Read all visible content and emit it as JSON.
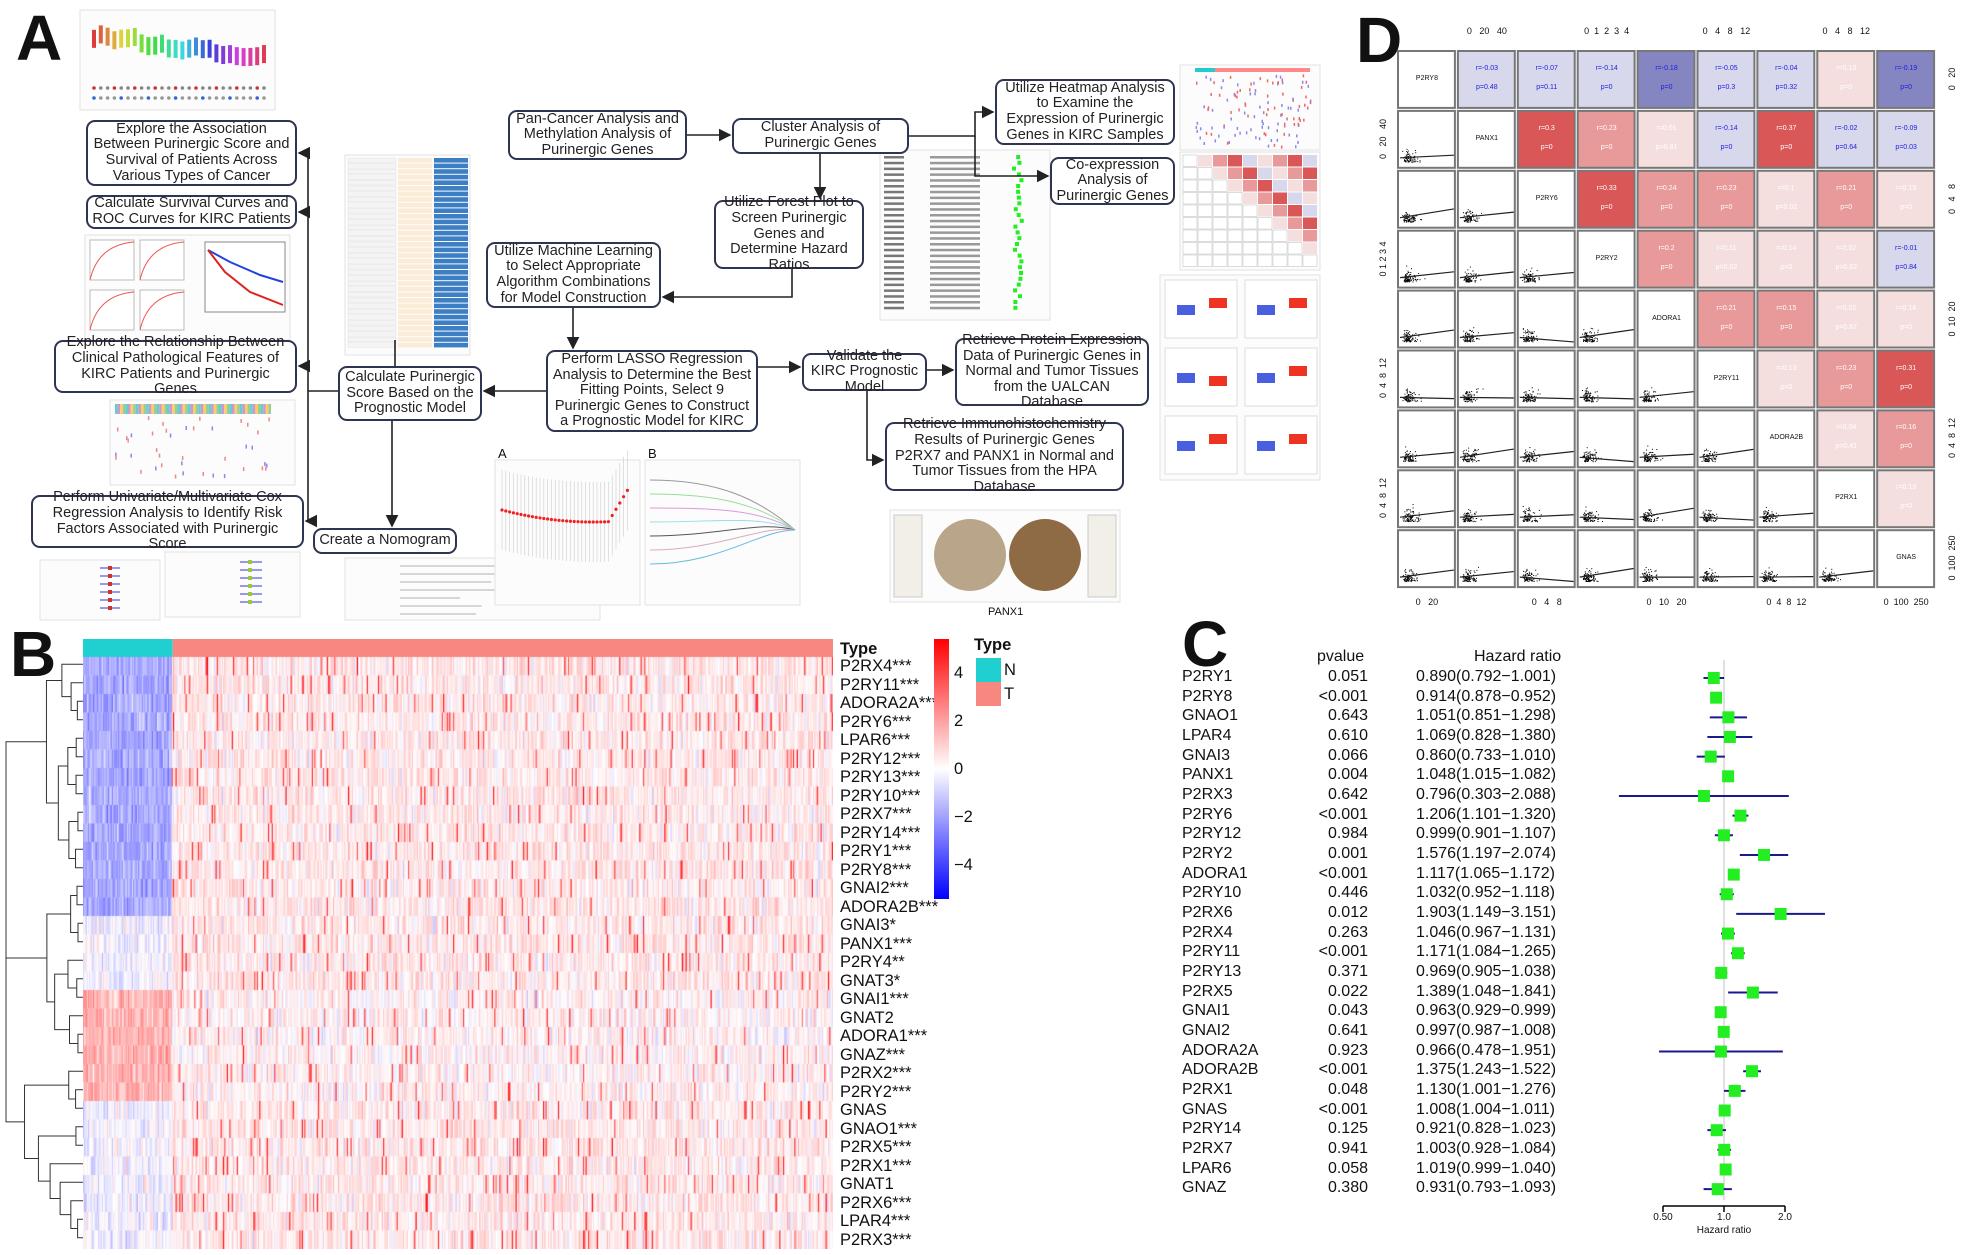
{
  "panels": {
    "a": "A",
    "b": "B",
    "c": "C",
    "d": "D"
  },
  "flowchart": {
    "boxes": [
      {
        "id": "explore-association",
        "text": "Explore the Association Between Purinergic Score and Survival of Patients Across Various Types of Cancer"
      },
      {
        "id": "survival-roc",
        "text": "Calculate Survival Curves and ROC Curves for KIRC Patients"
      },
      {
        "id": "clinical-features",
        "text": "Explore the Relationship Between Clinical Pathological Features of KIRC Patients and Purinergic Genes"
      },
      {
        "id": "cox-regression",
        "text": "Perform Univariate/Multivariate Cox Regression Analysis to Identify Risk Factors Associated with Purinergic Score"
      },
      {
        "id": "purinergic-score",
        "text": "Calculate Purinergic Score Based on the Prognostic Model"
      },
      {
        "id": "nomogram",
        "text": "Create a Nomogram"
      },
      {
        "id": "pan-cancer",
        "text": "Pan-Cancer Analysis and Methylation Analysis of Purinergic Genes"
      },
      {
        "id": "cluster-analysis",
        "text": "Cluster Analysis of Purinergic Genes"
      },
      {
        "id": "forest-plot",
        "text": "Utilize Forest Plot to Screen Purinergic Genes and Determine Hazard Ratios"
      },
      {
        "id": "machine-learning",
        "text": "Utilize Machine Learning to Select Appropriate Algorithm Combinations for Model Construction"
      },
      {
        "id": "lasso",
        "text": "Perform LASSO Regression Analysis to Determine the Best Fitting Points, Select 9 Purinergic Genes to Construct a Prognostic Model for KIRC"
      },
      {
        "id": "validate",
        "text": "Validate the KIRC Prognostic Model"
      },
      {
        "id": "protein-expression",
        "text": "Retrieve Protein Expression Data of Purinergic Genes in Normal and Tumor Tissues from the UALCAN Database"
      },
      {
        "id": "ihc",
        "text": "Retrieve Immunohistochemistry Results of Purinergic Genes P2RX7 and PANX1 in Normal and Tumor Tissues from the HPA Database"
      },
      {
        "id": "heatmap-analysis",
        "text": "Utilize Heatmap Analysis to Examine the Expression of Purinergic Genes in KIRC Samples"
      },
      {
        "id": "co-expression",
        "text": "Co-expression Analysis of Purinergic Genes"
      }
    ],
    "thumb_labels": {
      "lasso_a": "A",
      "lasso_b": "B",
      "ihc_gene": "PANX1"
    }
  },
  "chart_data": [
    {
      "panel": "B",
      "type": "heatmap",
      "annotation_title": "Type",
      "groups": [
        {
          "label": "N",
          "color": "#20d0d0"
        },
        {
          "label": "T",
          "color": "#f8877f"
        }
      ],
      "colorscale": {
        "ticks": [
          "4",
          "2",
          "0",
          "−2",
          "−4"
        ],
        "high": "#ff0000",
        "mid": "#ffffff",
        "low": "#0000ff"
      },
      "rows": [
        "P2RX4***",
        "P2RY11***",
        "ADORA2A***",
        "P2RY6***",
        "LPAR6***",
        "P2RY12***",
        "P2RY13***",
        "P2RY10***",
        "P2RX7***",
        "P2RY14***",
        "P2RY1***",
        "P2RY8***",
        "GNAI2***",
        "ADORA2B***",
        "GNAI3*",
        "PANX1***",
        "P2RY4**",
        "GNAT3*",
        "GNAI1***",
        "GNAT2",
        "ADORA1***",
        "GNAZ***",
        "P2RX2***",
        "P2RY2***",
        "GNAS",
        "GNAO1***",
        "P2RX5***",
        "P2RX1***",
        "GNAT1",
        "P2RX6***",
        "LPAR4***",
        "P2RX3***"
      ]
    },
    {
      "panel": "C",
      "type": "forest",
      "headers": {
        "pvalue": "pvalue",
        "hr": "Hazard ratio"
      },
      "xlabel": "Hazard ratio",
      "xscale": "log",
      "xticks": [
        "0.50",
        "1.0",
        "2.0"
      ],
      "xlim": [
        0.5,
        2.0
      ],
      "marker_color": "#22ee22",
      "ci_color": "#1a1a8c",
      "rows": [
        {
          "gene": "P2RY1",
          "p": "0.051",
          "hr_text": "0.890(0.792−1.001)",
          "hr": 0.89,
          "lo": 0.792,
          "hi": 1.001
        },
        {
          "gene": "P2RY8",
          "p": "<0.001",
          "hr_text": "0.914(0.878−0.952)",
          "hr": 0.914,
          "lo": 0.878,
          "hi": 0.952
        },
        {
          "gene": "GNAO1",
          "p": "0.643",
          "hr_text": "1.051(0.851−1.298)",
          "hr": 1.051,
          "lo": 0.851,
          "hi": 1.298
        },
        {
          "gene": "LPAR4",
          "p": "0.610",
          "hr_text": "1.069(0.828−1.380)",
          "hr": 1.069,
          "lo": 0.828,
          "hi": 1.38
        },
        {
          "gene": "GNAI3",
          "p": "0.066",
          "hr_text": "0.860(0.733−1.010)",
          "hr": 0.86,
          "lo": 0.733,
          "hi": 1.01
        },
        {
          "gene": "PANX1",
          "p": "0.004",
          "hr_text": "1.048(1.015−1.082)",
          "hr": 1.048,
          "lo": 1.015,
          "hi": 1.082
        },
        {
          "gene": "P2RX3",
          "p": "0.642",
          "hr_text": "0.796(0.303−2.088)",
          "hr": 0.796,
          "lo": 0.303,
          "hi": 2.088
        },
        {
          "gene": "P2RY6",
          "p": "<0.001",
          "hr_text": "1.206(1.101−1.320)",
          "hr": 1.206,
          "lo": 1.101,
          "hi": 1.32
        },
        {
          "gene": "P2RY12",
          "p": "0.984",
          "hr_text": "0.999(0.901−1.107)",
          "hr": 0.999,
          "lo": 0.901,
          "hi": 1.107
        },
        {
          "gene": "P2RY2",
          "p": "0.001",
          "hr_text": "1.576(1.197−2.074)",
          "hr": 1.576,
          "lo": 1.197,
          "hi": 2.074
        },
        {
          "gene": "ADORA1",
          "p": "<0.001",
          "hr_text": "1.117(1.065−1.172)",
          "hr": 1.117,
          "lo": 1.065,
          "hi": 1.172
        },
        {
          "gene": "P2RY10",
          "p": "0.446",
          "hr_text": "1.032(0.952−1.118)",
          "hr": 1.032,
          "lo": 0.952,
          "hi": 1.118
        },
        {
          "gene": "P2RX6",
          "p": "0.012",
          "hr_text": "1.903(1.149−3.151)",
          "hr": 1.903,
          "lo": 1.149,
          "hi": 3.151
        },
        {
          "gene": "P2RX4",
          "p": "0.263",
          "hr_text": "1.046(0.967−1.131)",
          "hr": 1.046,
          "lo": 0.967,
          "hi": 1.131
        },
        {
          "gene": "P2RY11",
          "p": "<0.001",
          "hr_text": "1.171(1.084−1.265)",
          "hr": 1.171,
          "lo": 1.084,
          "hi": 1.265
        },
        {
          "gene": "P2RY13",
          "p": "0.371",
          "hr_text": "0.969(0.905−1.038)",
          "hr": 0.969,
          "lo": 0.905,
          "hi": 1.038
        },
        {
          "gene": "P2RX5",
          "p": "0.022",
          "hr_text": "1.389(1.048−1.841)",
          "hr": 1.389,
          "lo": 1.048,
          "hi": 1.841
        },
        {
          "gene": "GNAI1",
          "p": "0.043",
          "hr_text": "0.963(0.929−0.999)",
          "hr": 0.963,
          "lo": 0.929,
          "hi": 0.999
        },
        {
          "gene": "GNAI2",
          "p": "0.641",
          "hr_text": "0.997(0.987−1.008)",
          "hr": 0.997,
          "lo": 0.987,
          "hi": 1.008
        },
        {
          "gene": "ADORA2A",
          "p": "0.923",
          "hr_text": "0.966(0.478−1.951)",
          "hr": 0.966,
          "lo": 0.478,
          "hi": 1.951
        },
        {
          "gene": "ADORA2B",
          "p": "<0.001",
          "hr_text": "1.375(1.243−1.522)",
          "hr": 1.375,
          "lo": 1.243,
          "hi": 1.522
        },
        {
          "gene": "P2RX1",
          "p": "0.048",
          "hr_text": "1.130(1.001−1.276)",
          "hr": 1.13,
          "lo": 1.001,
          "hi": 1.276
        },
        {
          "gene": "GNAS",
          "p": "<0.001",
          "hr_text": "1.008(1.004−1.011)",
          "hr": 1.008,
          "lo": 1.004,
          "hi": 1.011
        },
        {
          "gene": "P2RY14",
          "p": "0.125",
          "hr_text": "0.921(0.828−1.023)",
          "hr": 0.921,
          "lo": 0.828,
          "hi": 1.023
        },
        {
          "gene": "P2RX7",
          "p": "0.941",
          "hr_text": "1.003(0.928−1.084)",
          "hr": 1.003,
          "lo": 0.928,
          "hi": 1.084
        },
        {
          "gene": "LPAR6",
          "p": "0.058",
          "hr_text": "1.019(0.999−1.040)",
          "hr": 1.019,
          "lo": 0.999,
          "hi": 1.04
        },
        {
          "gene": "GNAZ",
          "p": "0.380",
          "hr_text": "0.931(0.793−1.093)",
          "hr": 0.931,
          "lo": 0.793,
          "hi": 1.093
        }
      ]
    },
    {
      "panel": "D",
      "type": "correlation-matrix",
      "genes": [
        "P2RY8",
        "PANX1",
        "P2RY6",
        "P2RY2",
        "ADORA1",
        "P2RY11",
        "ADORA2B",
        "P2RX1",
        "GNAS"
      ],
      "upper": [
        [
          {
            "r": "-0.03",
            "p": "0.48"
          },
          {
            "r": "-0.07",
            "p": "0.11"
          },
          {
            "r": "-0.14",
            "p": "0"
          },
          {
            "r": "-0.18",
            "p": "0"
          },
          {
            "r": "-0.05",
            "p": "0.3"
          },
          {
            "r": "-0.04",
            "p": "0.32"
          },
          {
            "r": "0.13",
            "p": "0"
          },
          {
            "r": "-0.19",
            "p": "0"
          }
        ],
        [
          {
            "r": "0.3",
            "p": "0"
          },
          {
            "r": "0.23",
            "p": "0"
          },
          {
            "r": "0.01",
            "p": "0.81"
          },
          {
            "r": "-0.14",
            "p": "0"
          },
          {
            "r": "0.37",
            "p": "0"
          },
          {
            "r": "-0.02",
            "p": "0.64"
          },
          {
            "r": "-0.09",
            "p": "0.03"
          }
        ],
        [
          {
            "r": "0.33",
            "p": "0"
          },
          {
            "r": "0.24",
            "p": "0"
          },
          {
            "r": "0.23",
            "p": "0"
          },
          {
            "r": "0.1",
            "p": "0.02"
          },
          {
            "r": "0.21",
            "p": "0"
          },
          {
            "r": "0.13",
            "p": "0"
          }
        ],
        [
          {
            "r": "0.2",
            "p": "0"
          },
          {
            "r": "0.11",
            "p": "0.02"
          },
          {
            "r": "0.14",
            "p": "0"
          },
          {
            "r": "0.02",
            "p": "0.62"
          },
          {
            "r": "-0.01",
            "p": "0.84"
          }
        ],
        [
          {
            "r": "0.21",
            "p": "0"
          },
          {
            "r": "0.15",
            "p": "0"
          },
          {
            "r": "0.02",
            "p": "0.67"
          },
          {
            "r": "0.14",
            "p": "0"
          }
        ],
        [
          {
            "r": "0.13",
            "p": "0"
          },
          {
            "r": "0.23",
            "p": "0"
          },
          {
            "r": "0.31",
            "p": "0"
          }
        ],
        [
          {
            "r": "0.04",
            "p": "0.41"
          },
          {
            "r": "0.16",
            "p": "0"
          }
        ],
        [
          {
            "r": "0.13",
            "p": "0"
          }
        ]
      ],
      "axis_ticks": {
        "top": [
          {
            "col": 1,
            "labels": "0   20   40"
          },
          {
            "col": 3,
            "labels": "0  1  2  3  4"
          },
          {
            "col": 5,
            "labels": "0   4   8   12"
          },
          {
            "col": 7,
            "labels": "0   4   8   12"
          }
        ],
        "bottom": [
          {
            "col": 0,
            "labels": "0   20"
          },
          {
            "col": 2,
            "labels": "0   4   8"
          },
          {
            "col": 4,
            "labels": "0   10   20"
          },
          {
            "col": 6,
            "labels": "0  4  8  12"
          },
          {
            "col": 8,
            "labels": "0  100  250"
          }
        ],
        "left": [
          {
            "row": 1,
            "labels": "0   20   40"
          },
          {
            "row": 3,
            "labels": "0 1 2 3 4"
          },
          {
            "row": 5,
            "labels": "0  4  8  12"
          },
          {
            "row": 7,
            "labels": "0  4  8  12"
          }
        ],
        "right": [
          {
            "row": 0,
            "labels": "0   20"
          },
          {
            "row": 2,
            "labels": "0   4   8"
          },
          {
            "row": 4,
            "labels": "0  10  20"
          },
          {
            "row": 6,
            "labels": "0  4  8  12"
          },
          {
            "row": 8,
            "labels": "0  100  250"
          }
        ]
      },
      "colors": {
        "neg_strong": "#8585c2",
        "neg_light": "#d8d8ec",
        "pos_strong": "#d95757",
        "pos_mid": "#e89999",
        "pos_light": "#f5dede",
        "neg_text": "#2020e0",
        "pos_text": "#ffffff"
      }
    }
  ]
}
